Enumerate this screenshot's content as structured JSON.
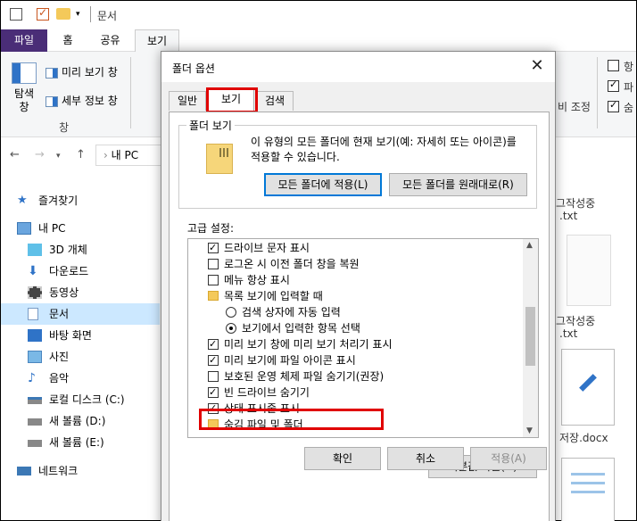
{
  "window": {
    "title": "문서"
  },
  "ribbon": {
    "tabs": [
      "파일",
      "홈",
      "공유",
      "보기"
    ],
    "active_tab": "보기",
    "nav_pane_btn": "탐색\n창",
    "preview_pane": "미리 보기 창",
    "details_pane": "세부 정보 창",
    "pane_group": "창",
    "resize_label": "비 조정",
    "right_checks": [
      {
        "label": "항",
        "checked": false
      },
      {
        "label": "파",
        "checked": true
      },
      {
        "label": "숨",
        "checked": true
      }
    ]
  },
  "address": {
    "path": "내 PC"
  },
  "nav": [
    {
      "label": "즐겨찾기",
      "icon": "star-icon"
    },
    {
      "label": "내 PC",
      "icon": "pc-icon"
    },
    {
      "label": "3D 개체",
      "icon": "cube-icon"
    },
    {
      "label": "다운로드",
      "icon": "download-icon"
    },
    {
      "label": "동영상",
      "icon": "video-icon"
    },
    {
      "label": "문서",
      "icon": "document-icon"
    },
    {
      "label": "바탕 화면",
      "icon": "desktop-icon"
    },
    {
      "label": "사진",
      "icon": "picture-icon"
    },
    {
      "label": "음악",
      "icon": "music-icon"
    },
    {
      "label": "로컬 디스크 (C:)",
      "icon": "drive-icon"
    },
    {
      "label": "새 볼륨 (D:)",
      "icon": "drive-icon"
    },
    {
      "label": "새 볼륨 (E:)",
      "icon": "drive-icon"
    },
    {
      "label": "네트워크",
      "icon": "network-icon"
    }
  ],
  "files": [
    {
      "name_line1": "그작성중",
      "name_line2": ".txt"
    },
    {
      "name_line1": "그작성중",
      "name_line2": ".txt"
    },
    {
      "name_line1": "저장.docx",
      "name_line2": ""
    }
  ],
  "dialog": {
    "title": "폴더 옵션",
    "tabs": [
      "일반",
      "보기",
      "검색"
    ],
    "active_tab": "보기",
    "folder_view": {
      "legend": "폴더 보기",
      "description": "이 유형의 모든 폴더에 현재 보기(예: 자세히 또는 아이콘)를 적용할 수 있습니다.",
      "apply_all": "모든 폴더에 적용(L)",
      "reset_all": "모든 폴더를 원래대로(R)"
    },
    "advanced_label": "고급 설정:",
    "settings": [
      {
        "type": "checkbox",
        "checked": true,
        "indent": 1,
        "label": "드라이브 문자 표시"
      },
      {
        "type": "checkbox",
        "checked": false,
        "indent": 1,
        "label": "로그온 시 이전 폴더 창을 복원"
      },
      {
        "type": "checkbox",
        "checked": false,
        "indent": 1,
        "label": "메뉴 항상 표시"
      },
      {
        "type": "folder",
        "checked": false,
        "indent": 1,
        "label": "목록 보기에 입력할 때"
      },
      {
        "type": "radio",
        "checked": false,
        "indent": 2,
        "label": "검색 상자에 자동 입력"
      },
      {
        "type": "radio",
        "checked": true,
        "indent": 2,
        "label": "보기에서 입력한 항목 선택"
      },
      {
        "type": "checkbox",
        "checked": true,
        "indent": 1,
        "label": "미리 보기 창에 미리 보기 처리기 표시"
      },
      {
        "type": "checkbox",
        "checked": true,
        "indent": 1,
        "label": "미리 보기에 파일 아이콘 표시"
      },
      {
        "type": "checkbox",
        "checked": false,
        "indent": 1,
        "label": "보호된 운영 체제 파일 숨기기(권장)"
      },
      {
        "type": "checkbox",
        "checked": true,
        "indent": 1,
        "label": "빈 드라이브 숨기기"
      },
      {
        "type": "checkbox",
        "checked": true,
        "indent": 1,
        "label": "상태 표시줄 표시"
      },
      {
        "type": "folder",
        "checked": false,
        "indent": 1,
        "label": "숨김 파일 및 폴더"
      }
    ],
    "restore_defaults": "기본값 복원(D)",
    "ok": "확인",
    "cancel": "취소",
    "apply": "적용(A)"
  }
}
